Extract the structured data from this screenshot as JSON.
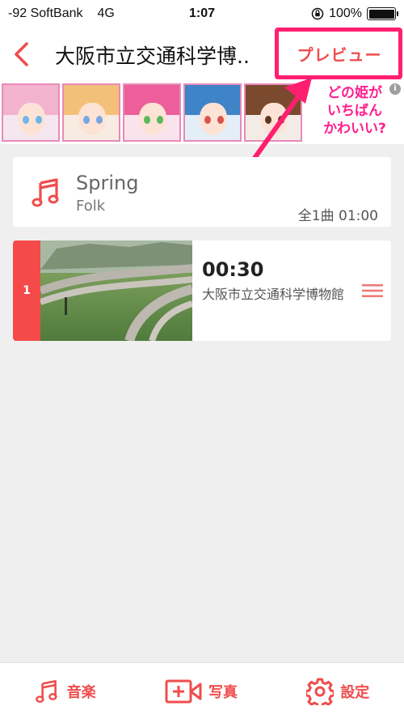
{
  "status_bar": {
    "carrier": "-92 SoftBank",
    "network": "4G",
    "time": "1:07",
    "battery_percent": "100%",
    "battery_level": 1.0
  },
  "nav": {
    "back_icon": "chevron-left-icon",
    "title": "大阪市立交通科学博..",
    "preview_label": "プレビュー",
    "accent_color": "#f04c4c",
    "highlight_color": "#ff1f6f"
  },
  "ad": {
    "text": "どの姫が\nいちばん\nかわいい?",
    "info_label": "i",
    "avatar_count": 5
  },
  "music_card": {
    "icon": "music-note-icon",
    "title": "Spring",
    "genre": "Folk",
    "summary": "全1曲  01:00"
  },
  "clips": [
    {
      "index": "1",
      "duration": "00:30",
      "caption": "大阪市立交通科学博物館",
      "drag_icon": "drag-handle-icon"
    }
  ],
  "tabs": [
    {
      "label": "音楽",
      "icon": "music-note-icon"
    },
    {
      "label": "写真",
      "icon": "photo-add-icon"
    },
    {
      "label": "設定",
      "icon": "gear-icon"
    }
  ]
}
